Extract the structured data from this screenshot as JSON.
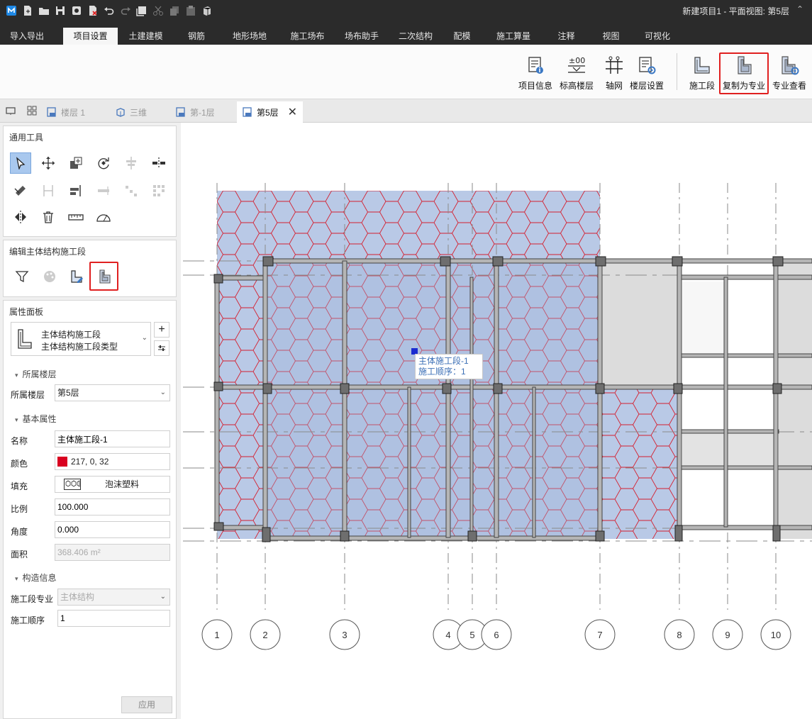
{
  "app": {
    "title": "新建项目1 - 平面视图: 第5层",
    "title_chevron": "⌃"
  },
  "quick_access": [
    "app-logo-icon",
    "new-file-icon",
    "open-folder-icon",
    "save-icon",
    "save-as-icon",
    "close-file-icon",
    "undo-icon",
    "redo-icon",
    "select-box-icon",
    "cut-icon",
    "copy-icon",
    "paste-icon",
    "cube-icon"
  ],
  "ribbon_tabs": [
    {
      "label": "导入导出",
      "active": false
    },
    {
      "label": "项目设置",
      "active": true
    },
    {
      "label": "土建建模",
      "active": false
    },
    {
      "label": "钢筋",
      "active": false
    },
    {
      "label": "地形场地",
      "active": false
    },
    {
      "label": "施工场布",
      "active": false
    },
    {
      "label": "场布助手",
      "active": false
    },
    {
      "label": "二次结构",
      "active": false
    },
    {
      "label": "配模",
      "active": false
    },
    {
      "label": "施工算量",
      "active": false
    },
    {
      "label": "注释",
      "active": false
    },
    {
      "label": "视图",
      "active": false
    },
    {
      "label": "可视化",
      "active": false
    }
  ],
  "ribbon_buttons": [
    {
      "label": "项目信息",
      "icon": "project-info-icon"
    },
    {
      "label": "标高楼层",
      "icon": "elevation-floor-icon"
    },
    {
      "label": "轴网",
      "icon": "axis-grid-icon"
    },
    {
      "label": "楼层设置",
      "icon": "floor-settings-icon"
    },
    {
      "label": "施工段",
      "icon": "construction-segment-icon"
    },
    {
      "label": "复制为专业",
      "icon": "copy-as-discipline-icon",
      "highlighted": true
    },
    {
      "label": "专业查看",
      "icon": "discipline-view-icon"
    }
  ],
  "doc_tabs": [
    {
      "label": "楼层 1",
      "active": false
    },
    {
      "label": "三维",
      "active": false
    },
    {
      "label": "第-1层",
      "active": false
    },
    {
      "label": "第5层",
      "active": true
    }
  ],
  "general_tools": {
    "title": "通用工具",
    "tools": [
      "select-pointer-icon",
      "move-icon",
      "copy-element-icon",
      "rotate-icon",
      "align-icon",
      "split-icon",
      "offset-icon",
      "trim-icon",
      "extend-icon",
      "break-icon",
      "array-icon",
      "array-grid-icon",
      "mirror-icon",
      "delete-icon",
      "measure-icon",
      "angle-measure-icon"
    ]
  },
  "segment_tools": {
    "title": "编辑主体结构施工段",
    "tools": [
      "filter-icon",
      "palette-icon",
      "edit-segment-icon",
      "copy-segment-icon"
    ]
  },
  "properties": {
    "title": "属性面板",
    "type_line1": "主体结构施工段",
    "type_line2": "主体结构施工段类型",
    "section_floor": "所属楼层",
    "floor_label": "所属楼层",
    "floor_value": "第5层",
    "section_basic": "基本属性",
    "name_label": "名称",
    "name_value": "主体施工段-1",
    "color_label": "颜色",
    "color_value": "217, 0, 32",
    "color_hex": "#d90020",
    "fill_label": "填充",
    "fill_value": "泡沫塑料",
    "scale_label": "比例",
    "scale_value": "100.000",
    "angle_label": "角度",
    "angle_value": "0.000",
    "area_label": "面积",
    "area_value": "368.406 m²",
    "section_construct": "构造信息",
    "discipline_label": "施工段专业",
    "discipline_value": "主体结构",
    "order_label": "施工顺序",
    "order_value": "1",
    "apply_label": "应用"
  },
  "canvas": {
    "tooltip_line1": "主体施工段-1",
    "tooltip_line2": "施工顺序：1",
    "axis_labels": [
      "1",
      "2",
      "3",
      "4",
      "5",
      "6",
      "7",
      "8",
      "9",
      "10"
    ]
  },
  "colors": {
    "accent_red": "#e02020",
    "segment_fill": "#b9c9e6",
    "hatch": "#d42030",
    "ribbon_dark": "#2b2b2b"
  }
}
